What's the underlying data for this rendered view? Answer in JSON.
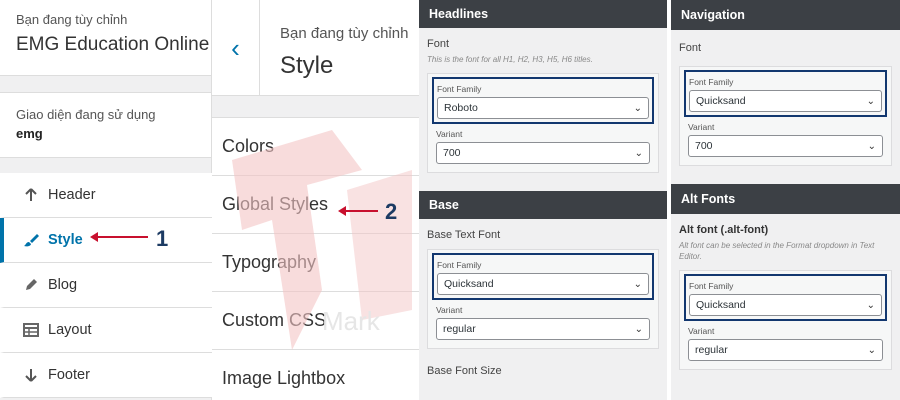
{
  "panel1": {
    "customizing_label": "Bạn đang tùy chỉnh",
    "site_name": "EMG Education Online",
    "active_theme_label": "Giao diện đang sử dụng",
    "active_theme_value": "emg",
    "items": [
      {
        "label": "Header",
        "icon": "arrow-up-icon"
      },
      {
        "label": "Style",
        "icon": "paint-brush-icon"
      },
      {
        "label": "Blog",
        "icon": "pencil-icon"
      },
      {
        "label": "Layout",
        "icon": "table-icon"
      },
      {
        "label": "Footer",
        "icon": "arrow-down-icon"
      }
    ],
    "annotation_number": "1"
  },
  "panel2": {
    "customizing_label": "Bạn đang tùy chỉnh",
    "title": "Style",
    "items": [
      "Colors",
      "Global Styles",
      "Typography",
      "Custom CSS",
      "Image Lightbox"
    ],
    "annotation_number": "2",
    "watermark_text": "Mark"
  },
  "headlines": {
    "header": "Headlines",
    "font_label": "Font",
    "font_desc": "This is the font for all H1, H2, H3, H5, H6 titles.",
    "family_label": "Font Family",
    "family_value": "Roboto",
    "variant_label": "Variant",
    "variant_value": "700"
  },
  "base": {
    "header": "Base",
    "font_label": "Base Text Font",
    "family_label": "Font Family",
    "family_value": "Quicksand",
    "variant_label": "Variant",
    "variant_value": "regular",
    "size_label": "Base Font Size"
  },
  "navigation": {
    "header": "Navigation",
    "font_label": "Font",
    "family_label": "Font Family",
    "family_value": "Quicksand",
    "variant_label": "Variant",
    "variant_value": "700"
  },
  "alt_fonts": {
    "header": "Alt Fonts",
    "font_label": "Alt font (.alt-font)",
    "font_desc": "Alt font can be selected in the Format dropdown in Text Editor.",
    "family_label": "Font Family",
    "family_value": "Quicksand",
    "variant_label": "Variant",
    "variant_value": "regular"
  },
  "colors": {
    "accent": "#0073aa",
    "annotation_arrow": "#c8102e",
    "highlight_box": "#12376f",
    "section_header": "#3c4045"
  }
}
